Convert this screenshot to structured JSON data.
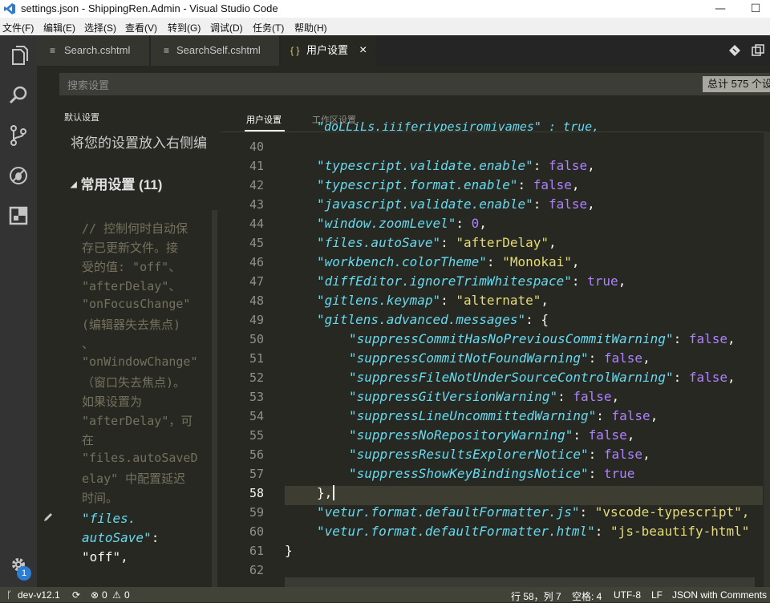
{
  "window": {
    "title": "settings.json - ShippingRen.Admin - Visual Studio Code",
    "minimize": "—",
    "maximize": "☐"
  },
  "menu": [
    "文件(F)",
    "编辑(E)",
    "选择(S)",
    "查看(V)",
    "转到(G)",
    "调试(D)",
    "任务(T)",
    "帮助(H)"
  ],
  "tabs": [
    {
      "label": "Search.cshtml",
      "icon": "≡"
    },
    {
      "label": "SearchSelf.cshtml",
      "icon": "≡"
    },
    {
      "label": "用户设置",
      "icon": "{ }",
      "close": "×"
    }
  ],
  "search": {
    "placeholder": "搜索设置",
    "count": "总计 575 个设"
  },
  "default_pane": {
    "header": "默认设置",
    "hint": "将您的设置放入右侧编",
    "group": "常用设置 (11)",
    "comment": [
      "// 控制何时自动保",
      "存已更新文件。接",
      "受的值: \"off\"、",
      "\"afterDelay\"、",
      "\"onFocusChange\"",
      "(编辑器失去焦点)",
      "、",
      "\"onWindowChange\"",
      "（窗口失去焦点)。",
      "如果设置为",
      "\"afterDelay\"，可",
      "在",
      "\"files.autoSaveD",
      "elay\" 中配置延迟",
      "时间。"
    ],
    "key_line1": "\"files.",
    "key_line2": "autoSave\"",
    "colon": ":",
    "value": "\"off\","
  },
  "editor_tabs": {
    "user": "用户设置",
    "workspace": "工作区设置"
  },
  "editor": {
    "partial_line": "\"doLLiLs.iiiferiypesiromivames\" : true,",
    "line_numbers": [
      "40",
      "41",
      "42",
      "43",
      "44",
      "45",
      "46",
      "47",
      "48",
      "49",
      "50",
      "51",
      "52",
      "53",
      "54",
      "55",
      "56",
      "57",
      "58",
      "59",
      "60",
      "61",
      "62"
    ],
    "lines": [
      {
        "key": "",
        "val": ""
      },
      {
        "key": "\"typescript.validate.enable\"",
        "val": "false"
      },
      {
        "key": "\"typescript.format.enable\"",
        "val": "false"
      },
      {
        "key": "\"javascript.validate.enable\"",
        "val": "false"
      },
      {
        "key": "\"window.zoomLevel\"",
        "val": "0"
      },
      {
        "key": "\"files.autoSave\"",
        "val": "\"afterDelay\""
      },
      {
        "key": "\"workbench.colorTheme\"",
        "val": "\"Monokai\""
      },
      {
        "key": "\"diffEditor.ignoreTrimWhitespace\"",
        "val": "true"
      },
      {
        "key": "\"gitlens.keymap\"",
        "val": "\"alternate\""
      },
      {
        "key": "\"gitlens.advanced.messages\"",
        "val": "{"
      },
      {
        "key": "\"suppressCommitHasNoPreviousCommitWarning\"",
        "val": "false"
      },
      {
        "key": "\"suppressCommitNotFoundWarning\"",
        "val": "false"
      },
      {
        "key": "\"suppressFileNotUnderSourceControlWarning\"",
        "val": "false"
      },
      {
        "key": "\"suppressGitVersionWarning\"",
        "val": "false"
      },
      {
        "key": "\"suppressLineUncommittedWarning\"",
        "val": "false"
      },
      {
        "key": "\"suppressNoRepositoryWarning\"",
        "val": "false"
      },
      {
        "key": "\"suppressResultsExplorerNotice\"",
        "val": "false"
      },
      {
        "key": "\"suppressShowKeyBindingsNotice\"",
        "val": "true"
      },
      {
        "key": "}",
        "val": ","
      },
      {
        "key": "\"vetur.format.defaultFormatter.js\"",
        "val": "\"vscode-typescript\","
      },
      {
        "key": "\"vetur.format.defaultFormatter.html\"",
        "val": "\"js-beautify-html\""
      },
      {
        "key": "}",
        "val": ""
      },
      {
        "key": "",
        "val": ""
      }
    ]
  },
  "status": {
    "branch": "dev-v12.1",
    "errors": "0",
    "warnings": "0",
    "position": "行 58，列 7",
    "indent": "空格: 4",
    "encoding": "UTF-8",
    "eol": "LF",
    "language": "JSON with Comments"
  },
  "badge": "1",
  "colors": {
    "background": "#272822",
    "key": "#66d9ef",
    "string": "#e6db74",
    "literal": "#ae81ff"
  }
}
